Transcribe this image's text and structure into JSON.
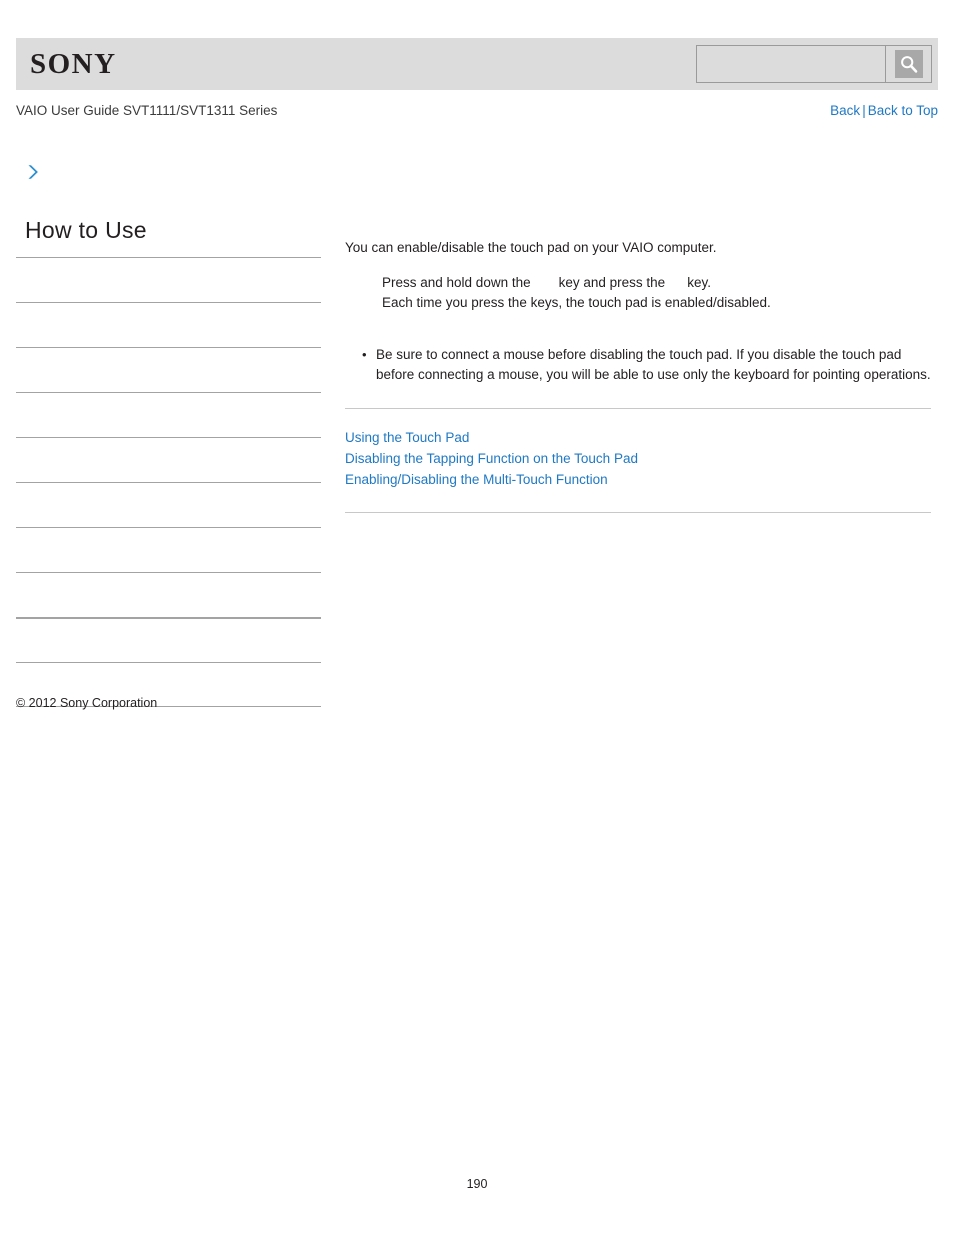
{
  "header": {
    "logo_text": "SONY",
    "search_value": "",
    "search_placeholder": "",
    "search_icon": "magnifier-icon"
  },
  "subtitle": {
    "guide_title": "VAIO User Guide SVT1111/SVT1311 Series",
    "back_label": "Back",
    "separator": "|",
    "back_to_top_label": "Back to Top"
  },
  "sidebar": {
    "chevron_icon": "chevron-right-icon",
    "heading": "How to Use",
    "items": [
      {
        "label": ""
      },
      {
        "label": ""
      },
      {
        "label": ""
      },
      {
        "label": ""
      },
      {
        "label": ""
      },
      {
        "label": ""
      },
      {
        "label": ""
      },
      {
        "label": ""
      },
      {
        "label": ""
      },
      {
        "label": ""
      }
    ]
  },
  "content": {
    "intro": "You can enable/disable the touch pad on your VAIO computer.",
    "step_prefix": "Press and hold down the",
    "step_middle": "key and press the",
    "step_suffix": "key.",
    "step_line2": "Each time you press the keys, the touch pad is enabled/disabled.",
    "notes": [
      "Be sure to connect a mouse before disabling the touch pad. If you disable the touch pad before connecting a mouse, you will be able to use only the keyboard for pointing operations."
    ],
    "related_links": [
      "Using the Touch Pad",
      "Disabling the Tapping Function on the Touch Pad",
      "Enabling/Disabling the Multi-Touch Function"
    ]
  },
  "footer": {
    "copyright": "© 2012 Sony Corporation",
    "page_number": "190"
  },
  "colors": {
    "link_blue": "#2079c4",
    "header_gray": "#dcdcdc",
    "text_black": "#231f20",
    "rule_gray": "#a3a3a3"
  }
}
